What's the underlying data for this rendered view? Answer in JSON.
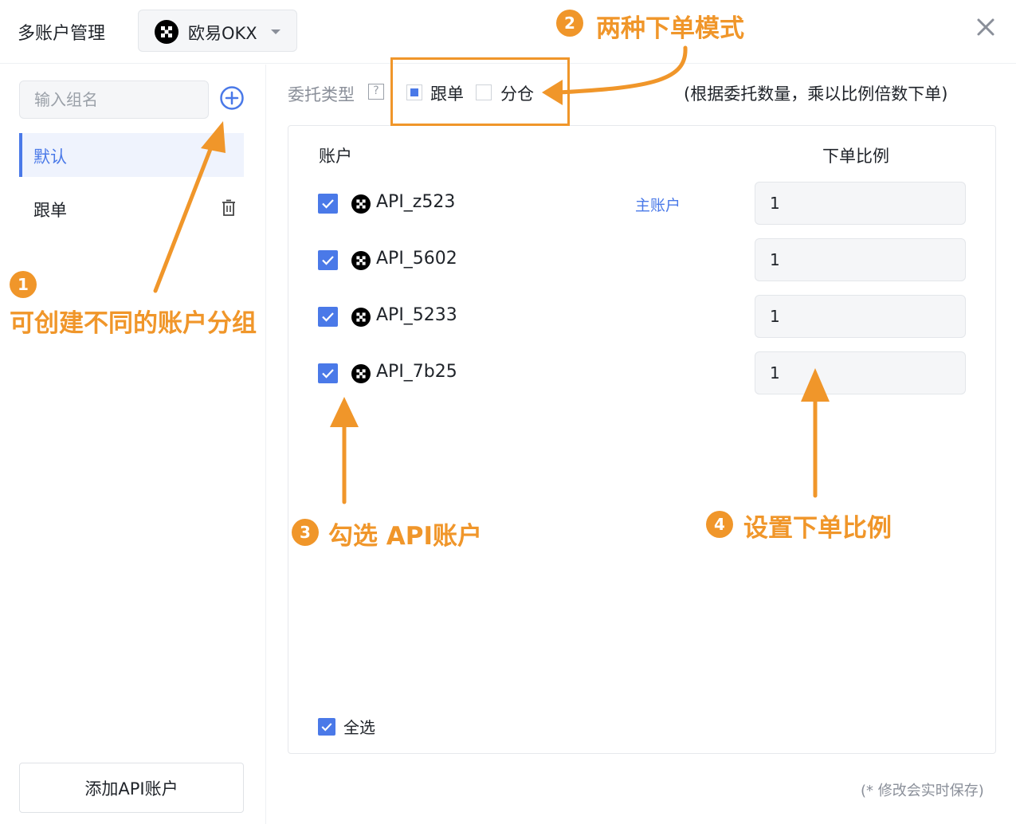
{
  "header": {
    "title": "多账户管理",
    "exchange": {
      "label": "欧易OKX",
      "icon": "okx-logo-icon"
    },
    "close_icon": "close-icon"
  },
  "sidebar": {
    "search": {
      "placeholder": "输入组名",
      "value": ""
    },
    "add_icon": "plus-circle-icon",
    "groups": [
      {
        "label": "默认",
        "active": true
      },
      {
        "label": "跟单",
        "active": false,
        "icon": "trash-icon"
      }
    ],
    "add_api_label": "添加API账户"
  },
  "order_type": {
    "label": "委托类型",
    "help_glyph": "?",
    "modes": [
      {
        "label": "跟单",
        "selected": true
      },
      {
        "label": "分仓",
        "selected": false
      }
    ],
    "hint": "(根据委托数量，乘以比例倍数下单)"
  },
  "accounts": {
    "col_account": "账户",
    "col_ratio": "下单比例",
    "rows": [
      {
        "name": "API_z523",
        "tag": "主账户",
        "ratio": "1",
        "checked": true
      },
      {
        "name": "API_5602",
        "tag": "",
        "ratio": "1",
        "checked": true
      },
      {
        "name": "API_5233",
        "tag": "",
        "ratio": "1",
        "checked": true
      },
      {
        "name": "API_7b25",
        "tag": "",
        "ratio": "1",
        "checked": true
      }
    ],
    "select_all_label": "全选",
    "select_all_checked": true
  },
  "save_note": "(* 修改会实时保存)",
  "annotations": [
    {
      "number": "1",
      "text": "可创建不同的账户分组"
    },
    {
      "number": "2",
      "text": "两种下单模式"
    },
    {
      "number": "3",
      "text": "勾选 API账户"
    },
    {
      "number": "4",
      "text": "设置下单比例"
    }
  ],
  "colors": {
    "accent": "#4a79e8",
    "annotation": "#f0962a",
    "input_bg": "#f5f6f8"
  }
}
